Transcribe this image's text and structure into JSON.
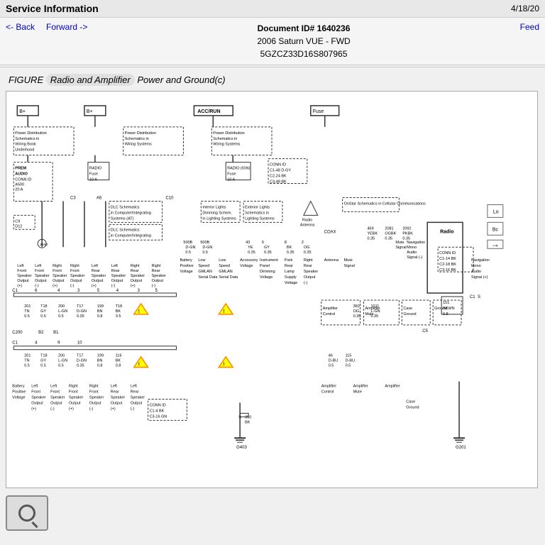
{
  "header": {
    "title": "Service Information",
    "date": "4/18/20"
  },
  "nav": {
    "back_label": "<- Back",
    "forward_label": "Forward ->",
    "feed_label": "Feed",
    "doc_id": "Document ID# 1640236",
    "vehicle": "2006 Saturn VUE - FWD",
    "vin": "5GZCZ33D16S807965"
  },
  "figure": {
    "title_prefix": "FIGURE ",
    "title_highlight": "Radio and Amplifier",
    "title_suffix": " Power and Ground(c)"
  },
  "diagram": {
    "description": "Wiring diagram for Radio and Amplifier Power and Ground"
  },
  "bottom": {
    "search_icon": "search-icon"
  }
}
